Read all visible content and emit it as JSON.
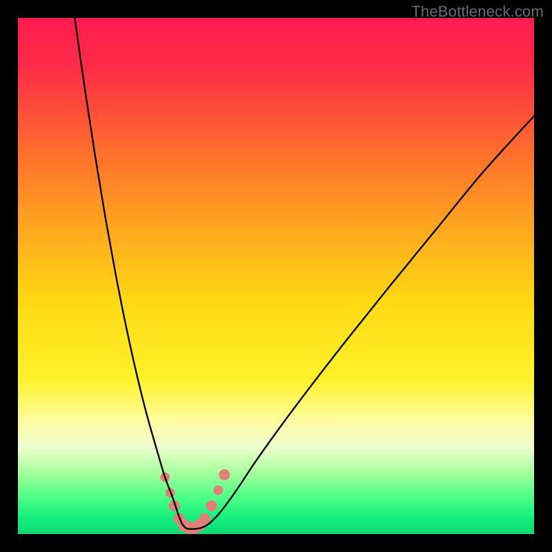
{
  "watermark": "TheBottleneck.com",
  "chart_data": {
    "type": "line",
    "title": "",
    "xlabel": "",
    "ylabel": "",
    "x_range": [
      0,
      100
    ],
    "y_range": [
      0,
      100
    ],
    "gradient_stops": [
      {
        "offset": 0.0,
        "color": "#ff1a4f"
      },
      {
        "offset": 0.1,
        "color": "#ff2e46"
      },
      {
        "offset": 0.25,
        "color": "#ff6a2e"
      },
      {
        "offset": 0.4,
        "color": "#ffa41f"
      },
      {
        "offset": 0.55,
        "color": "#ffd914"
      },
      {
        "offset": 0.7,
        "color": "#fff22a"
      },
      {
        "offset": 0.78,
        "color": "#fffca0"
      },
      {
        "offset": 0.83,
        "color": "#f0ffd0"
      },
      {
        "offset": 0.88,
        "color": "#a8ff9e"
      },
      {
        "offset": 0.93,
        "color": "#4bff86"
      },
      {
        "offset": 0.97,
        "color": "#13ee7e"
      },
      {
        "offset": 1.0,
        "color": "#0fd973"
      }
    ],
    "series": [
      {
        "name": "bottleneck-curve",
        "color": "#000000",
        "x": [
          11.0,
          13.0,
          15.0,
          17.0,
          19.0,
          21.0,
          23.0,
          25.0,
          27.0,
          28.5,
          30.0,
          31.0,
          31.8,
          32.5,
          33.0,
          34.0,
          35.5,
          37.0,
          39.0,
          42.0,
          46.0,
          51.0,
          57.0,
          64.0,
          72.0,
          81.0,
          90.0,
          100.0
        ],
        "y": [
          100.0,
          86.0,
          73.0,
          61.0,
          50.0,
          40.0,
          31.0,
          23.0,
          16.0,
          11.0,
          7.0,
          4.0,
          2.0,
          1.2,
          1.0,
          1.0,
          1.2,
          2.0,
          4.0,
          8.0,
          14.0,
          21.0,
          29.0,
          38.0,
          48.0,
          59.0,
          70.0,
          81.0
        ]
      }
    ],
    "annotations": [
      {
        "name": "trough-marker",
        "kind": "blob",
        "color": "#e08078",
        "points": [
          {
            "x": 28.5,
            "y": 11.0,
            "r": 7
          },
          {
            "x": 29.5,
            "y": 8.0,
            "r": 7
          },
          {
            "x": 30.3,
            "y": 5.5,
            "r": 8
          },
          {
            "x": 31.2,
            "y": 3.0,
            "r": 8
          },
          {
            "x": 32.2,
            "y": 1.7,
            "r": 9
          },
          {
            "x": 33.2,
            "y": 1.2,
            "r": 9
          },
          {
            "x": 34.2,
            "y": 1.2,
            "r": 9
          },
          {
            "x": 35.2,
            "y": 1.7,
            "r": 9
          },
          {
            "x": 36.2,
            "y": 3.0,
            "r": 8
          },
          {
            "x": 37.5,
            "y": 5.5,
            "r": 8
          },
          {
            "x": 38.8,
            "y": 8.5,
            "r": 7
          },
          {
            "x": 40.0,
            "y": 11.5,
            "r": 8
          }
        ]
      }
    ]
  }
}
